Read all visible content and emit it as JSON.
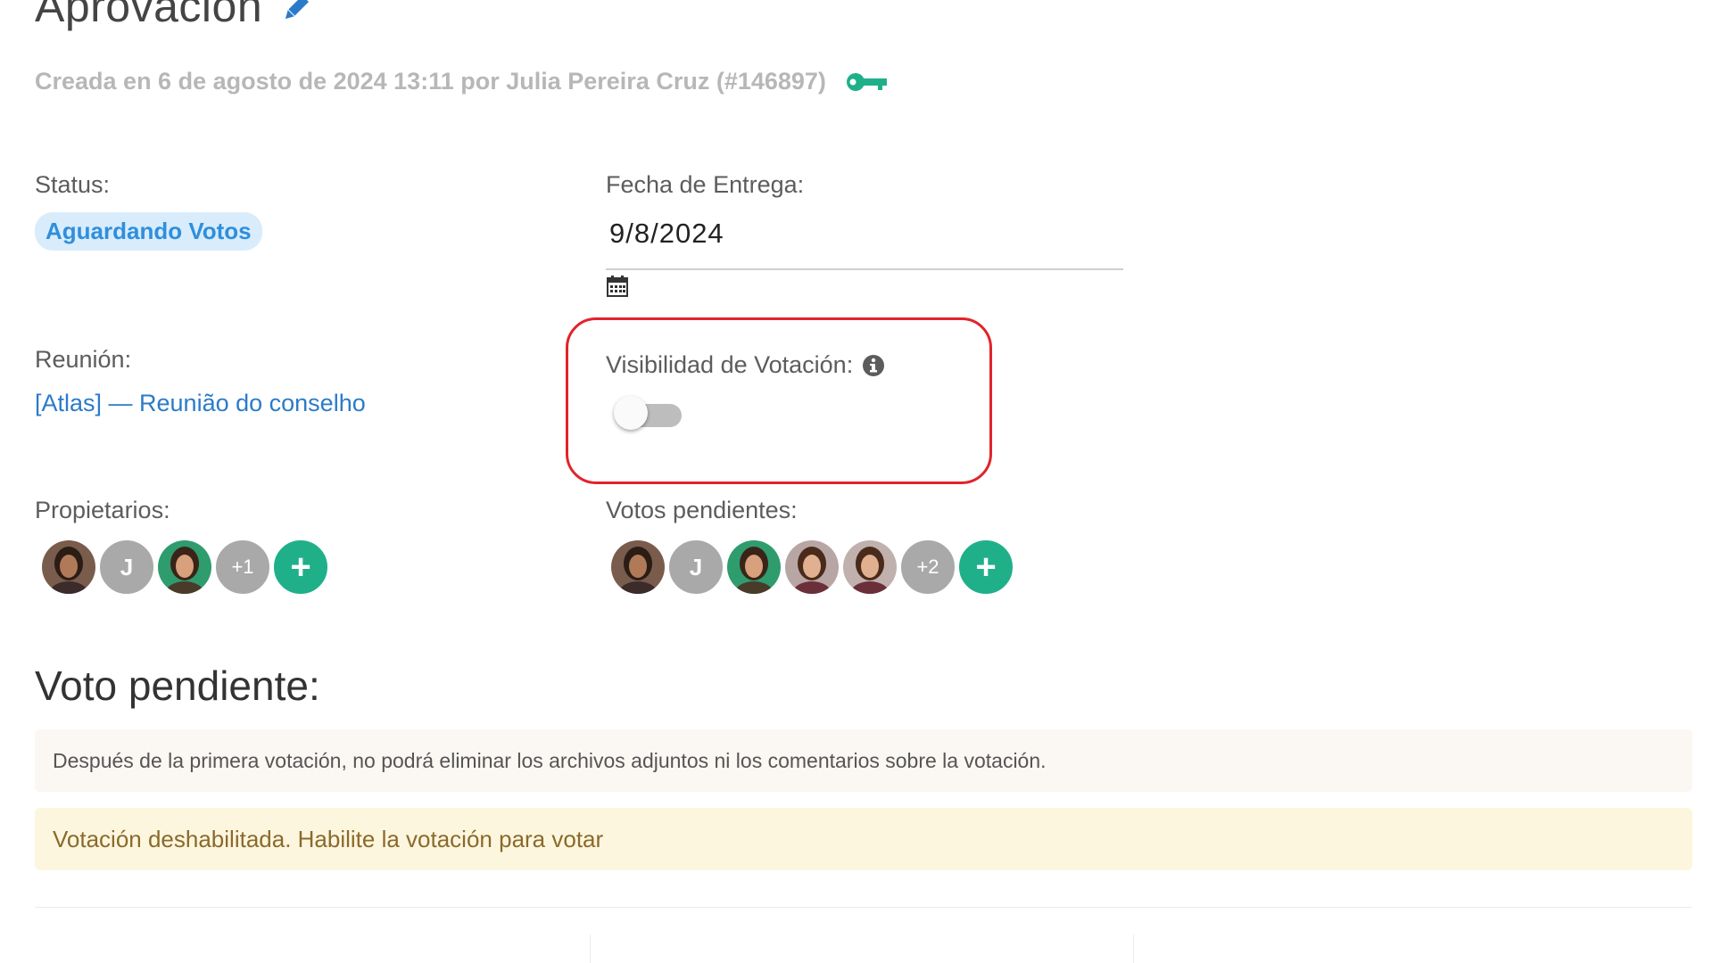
{
  "header": {
    "title": "Aprovación",
    "meta": "Creada en 6 de agosto de 2024 13:11 por Julia Pereira Cruz (#146897)",
    "pencil_icon": "pencil-icon",
    "key_icon": "key-icon"
  },
  "status": {
    "label": "Status:",
    "value": "Aguardando Votos"
  },
  "due_date": {
    "label": "Fecha de Entrega:",
    "value": "9/8/2024",
    "icon": "calendar-icon"
  },
  "meeting": {
    "label": "Reunión:",
    "link": "[Atlas] — Reunião do conselho"
  },
  "visibility": {
    "label": "Visibilidad de Votación:",
    "icon": "info-icon",
    "enabled": false
  },
  "owners": {
    "label": "Propietarios:",
    "avatars": [
      {
        "type": "photo"
      },
      {
        "type": "initial",
        "text": "J"
      },
      {
        "type": "photo"
      },
      {
        "type": "more",
        "text": "+1"
      },
      {
        "type": "add",
        "text": "+"
      }
    ]
  },
  "pending_votes": {
    "label": "Votos pendientes:",
    "avatars": [
      {
        "type": "photo"
      },
      {
        "type": "initial",
        "text": "J"
      },
      {
        "type": "photo"
      },
      {
        "type": "photo"
      },
      {
        "type": "photo"
      },
      {
        "type": "more",
        "text": "+2"
      },
      {
        "type": "add",
        "text": "+"
      }
    ]
  },
  "vote_section": {
    "title": "Voto pendiente:",
    "info_message": "Después de la primera votación, no podrá eliminar los archivos adjuntos ni los comentarios sobre la votación.",
    "warning_message": "Votación deshabilitada. Habilite la votación para votar"
  },
  "colors": {
    "accent_green": "#1fb08a",
    "link_blue": "#2b7bc8",
    "badge_blue": "#2e8fdd",
    "highlight_red": "#e2232a"
  }
}
